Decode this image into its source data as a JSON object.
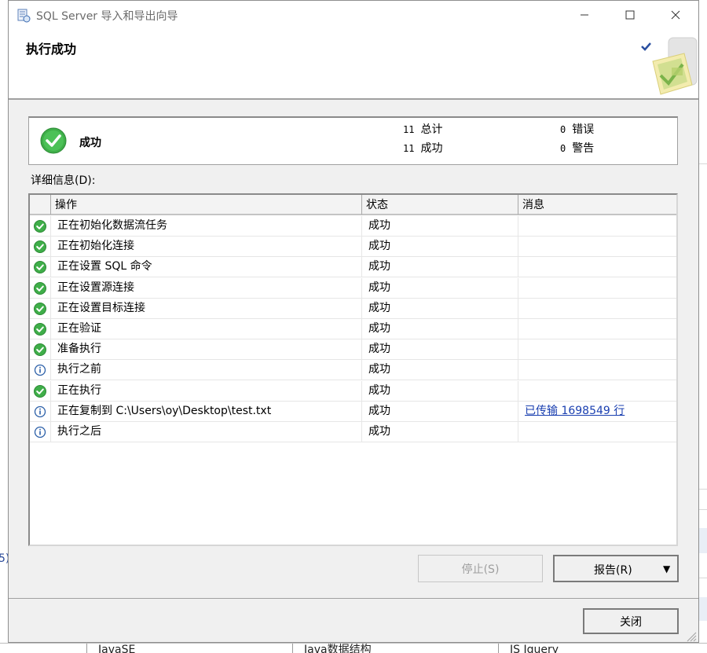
{
  "window": {
    "title": "SQL Server 导入和导出向导",
    "icon": "wizard-app-icon",
    "controls": {
      "minimize": "minimize-icon",
      "maximize": "maximize-icon",
      "close": "close-icon"
    }
  },
  "header": {
    "title": "执行成功",
    "graphic": "checkmark-sheet-graphic"
  },
  "summary": {
    "status": "成功",
    "status_icon": "success-icon",
    "total_count": "11",
    "total_label": "总计",
    "success_count": "11",
    "success_label": "成功",
    "error_count": "0",
    "error_label": "错误",
    "warning_count": "0",
    "warning_label": "警告"
  },
  "details": {
    "label": "详细信息(D):",
    "columns": [
      "操作",
      "状态",
      "消息"
    ],
    "rows": [
      {
        "icon": "success-icon",
        "action": "正在初始化数据流任务",
        "status": "成功",
        "message": ""
      },
      {
        "icon": "success-icon",
        "action": "正在初始化连接",
        "status": "成功",
        "message": ""
      },
      {
        "icon": "success-icon",
        "action": "正在设置 SQL 命令",
        "status": "成功",
        "message": ""
      },
      {
        "icon": "success-icon",
        "action": "正在设置源连接",
        "status": "成功",
        "message": ""
      },
      {
        "icon": "success-icon",
        "action": "正在设置目标连接",
        "status": "成功",
        "message": ""
      },
      {
        "icon": "success-icon",
        "action": "正在验证",
        "status": "成功",
        "message": ""
      },
      {
        "icon": "success-icon",
        "action": "准备执行",
        "status": "成功",
        "message": ""
      },
      {
        "icon": "info-icon",
        "action": "执行之前",
        "status": "成功",
        "message": ""
      },
      {
        "icon": "success-icon",
        "action": "正在执行",
        "status": "成功",
        "message": ""
      },
      {
        "icon": "info-icon",
        "action": "正在复制到 C:\\Users\\oy\\Desktop\\test.txt",
        "status": "成功",
        "message": "已传输 1698549 行"
      },
      {
        "icon": "info-icon",
        "action": "执行之后",
        "status": "成功",
        "message": ""
      }
    ]
  },
  "buttons": {
    "stop": "停止(S)",
    "report": "报告(R)",
    "close": "关闭"
  },
  "background": {
    "left_fragment": "5)",
    "bottom_cells": [
      "JavaSE",
      "Java数据结构",
      "JS Jquery"
    ]
  },
  "colors": {
    "success_green": "#3fae49",
    "info_blue": "#2b5fa8",
    "link_blue": "#1a3fb0",
    "dialog_bg": "#f0f0f0"
  }
}
